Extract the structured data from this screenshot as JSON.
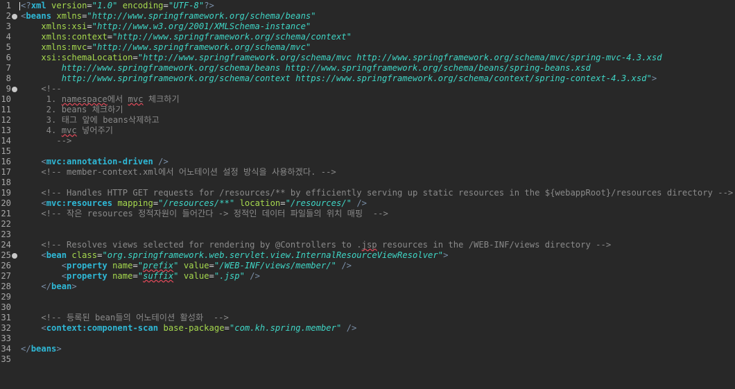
{
  "editor": {
    "lines": [
      {
        "n": "1",
        "fold": false,
        "parts": [
          {
            "c": "tag",
            "t": "<?"
          },
          {
            "c": "tn",
            "t": "xml"
          },
          {
            "c": "txt",
            "t": " "
          },
          {
            "c": "attr",
            "t": "version"
          },
          {
            "c": "txt",
            "t": "="
          },
          {
            "c": "val",
            "t": "\"1.0\""
          },
          {
            "c": "txt",
            "t": " "
          },
          {
            "c": "attr",
            "t": "encoding"
          },
          {
            "c": "txt",
            "t": "="
          },
          {
            "c": "val",
            "t": "\"UTF-8\""
          },
          {
            "c": "tag",
            "t": "?>"
          }
        ]
      },
      {
        "n": "2",
        "fold": true,
        "parts": [
          {
            "c": "tag",
            "t": "<"
          },
          {
            "c": "tn",
            "t": "beans"
          },
          {
            "c": "txt",
            "t": " "
          },
          {
            "c": "attr",
            "t": "xmlns"
          },
          {
            "c": "txt",
            "t": "="
          },
          {
            "c": "val",
            "t": "\"http://www.springframework.org/schema/beans\""
          }
        ]
      },
      {
        "n": "3",
        "fold": false,
        "parts": [
          {
            "c": "txt",
            "t": "    "
          },
          {
            "c": "attr",
            "t": "xmlns:xsi"
          },
          {
            "c": "txt",
            "t": "="
          },
          {
            "c": "val",
            "t": "\"http://www.w3.org/2001/XMLSchema-instance\""
          }
        ]
      },
      {
        "n": "4",
        "fold": false,
        "parts": [
          {
            "c": "txt",
            "t": "    "
          },
          {
            "c": "attr",
            "t": "xmlns:context"
          },
          {
            "c": "txt",
            "t": "="
          },
          {
            "c": "val",
            "t": "\"http://www.springframework.org/schema/context\""
          }
        ]
      },
      {
        "n": "5",
        "fold": false,
        "parts": [
          {
            "c": "txt",
            "t": "    "
          },
          {
            "c": "attr",
            "t": "xmlns:mvc"
          },
          {
            "c": "txt",
            "t": "="
          },
          {
            "c": "val",
            "t": "\"http://www.springframework.org/schema/mvc\""
          }
        ]
      },
      {
        "n": "6",
        "fold": false,
        "parts": [
          {
            "c": "txt",
            "t": "    "
          },
          {
            "c": "attr",
            "t": "xsi:schemaLocation"
          },
          {
            "c": "txt",
            "t": "="
          },
          {
            "c": "val",
            "t": "\"http://www.springframework.org/schema/mvc http://www.springframework.org/schema/mvc/spring-mvc-4.3.xsd"
          }
        ]
      },
      {
        "n": "7",
        "fold": false,
        "parts": [
          {
            "c": "val",
            "t": "        http://www.springframework.org/schema/beans http://www.springframework.org/schema/beans/spring-beans.xsd"
          }
        ]
      },
      {
        "n": "8",
        "fold": false,
        "parts": [
          {
            "c": "val",
            "t": "        http://www.springframework.org/schema/context https://www.springframework.org/schema/context/spring-context-4.3.xsd\""
          },
          {
            "c": "tag",
            "t": ">"
          }
        ]
      },
      {
        "n": "9",
        "fold": true,
        "parts": [
          {
            "c": "cmt",
            "t": "    <!--"
          }
        ]
      },
      {
        "n": "10",
        "fold": false,
        "parts": [
          {
            "c": "cmt",
            "t": "     1. "
          },
          {
            "c": "cmt sq",
            "t": "namespace"
          },
          {
            "c": "cmt",
            "t": "에서 "
          },
          {
            "c": "cmt sq",
            "t": "mvc"
          },
          {
            "c": "cmt",
            "t": " 체크하기"
          }
        ]
      },
      {
        "n": "11",
        "fold": false,
        "parts": [
          {
            "c": "cmt",
            "t": "     2. beans 체크하기"
          }
        ]
      },
      {
        "n": "12",
        "fold": false,
        "parts": [
          {
            "c": "cmt",
            "t": "     3. 태그 앞에 beans삭제하고"
          }
        ]
      },
      {
        "n": "13",
        "fold": false,
        "parts": [
          {
            "c": "cmt",
            "t": "     4. "
          },
          {
            "c": "cmt sq",
            "t": "mvc"
          },
          {
            "c": "cmt",
            "t": " 넣어주기"
          }
        ]
      },
      {
        "n": "14",
        "fold": false,
        "parts": [
          {
            "c": "cmt",
            "t": "       -->"
          }
        ]
      },
      {
        "n": "15",
        "fold": false,
        "parts": []
      },
      {
        "n": "16",
        "fold": false,
        "parts": [
          {
            "c": "txt",
            "t": "    "
          },
          {
            "c": "tag",
            "t": "<"
          },
          {
            "c": "tn",
            "t": "mvc:annotation-driven"
          },
          {
            "c": "txt",
            "t": " "
          },
          {
            "c": "tag",
            "t": "/>"
          }
        ]
      },
      {
        "n": "17",
        "fold": false,
        "parts": [
          {
            "c": "cmt",
            "t": "    <!-- member-context.xml에서 어노테이션 설정 방식을 사용하겠다. -->"
          }
        ]
      },
      {
        "n": "18",
        "fold": false,
        "parts": []
      },
      {
        "n": "19",
        "fold": false,
        "parts": [
          {
            "c": "cmt",
            "t": "    <!-- Handles HTTP GET requests for /resources/** by efficiently serving up static resources in the ${webappRoot}/resources directory -->"
          }
        ]
      },
      {
        "n": "20",
        "fold": false,
        "parts": [
          {
            "c": "txt",
            "t": "    "
          },
          {
            "c": "tag",
            "t": "<"
          },
          {
            "c": "tn",
            "t": "mvc:resources"
          },
          {
            "c": "txt",
            "t": " "
          },
          {
            "c": "attr",
            "t": "mapping"
          },
          {
            "c": "txt",
            "t": "="
          },
          {
            "c": "val",
            "t": "\"/resources/**\""
          },
          {
            "c": "txt",
            "t": " "
          },
          {
            "c": "attr",
            "t": "location"
          },
          {
            "c": "txt",
            "t": "="
          },
          {
            "c": "val",
            "t": "\"/resources/\""
          },
          {
            "c": "txt",
            "t": " "
          },
          {
            "c": "tag",
            "t": "/>"
          }
        ]
      },
      {
        "n": "21",
        "fold": false,
        "parts": [
          {
            "c": "cmt",
            "t": "    <!-- 작은 resources 정적자원이 들어간다 -> 정적인 데이터 파일들의 위치 매핑  -->"
          }
        ]
      },
      {
        "n": "22",
        "fold": false,
        "parts": []
      },
      {
        "n": "23",
        "fold": false,
        "parts": []
      },
      {
        "n": "24",
        "fold": false,
        "parts": [
          {
            "c": "cmt",
            "t": "    <!-- Resolves views selected for rendering by @Controllers to ."
          },
          {
            "c": "cmt sq",
            "t": "jsp"
          },
          {
            "c": "cmt",
            "t": " resources in the /WEB-INF/views directory -->"
          }
        ]
      },
      {
        "n": "25",
        "fold": true,
        "parts": [
          {
            "c": "txt",
            "t": "    "
          },
          {
            "c": "tag",
            "t": "<"
          },
          {
            "c": "tn",
            "t": "bean"
          },
          {
            "c": "txt",
            "t": " "
          },
          {
            "c": "attr",
            "t": "class"
          },
          {
            "c": "txt",
            "t": "="
          },
          {
            "c": "val",
            "t": "\"org.springframework.web.servlet.view.InternalResourceViewResolver\""
          },
          {
            "c": "tag",
            "t": ">"
          }
        ]
      },
      {
        "n": "26",
        "fold": false,
        "parts": [
          {
            "c": "txt",
            "t": "        "
          },
          {
            "c": "tag",
            "t": "<"
          },
          {
            "c": "tn",
            "t": "property"
          },
          {
            "c": "txt",
            "t": " "
          },
          {
            "c": "attr",
            "t": "name"
          },
          {
            "c": "txt",
            "t": "="
          },
          {
            "c": "val",
            "t": "\""
          },
          {
            "c": "val sq",
            "t": "prefix"
          },
          {
            "c": "val",
            "t": "\""
          },
          {
            "c": "txt",
            "t": " "
          },
          {
            "c": "attr",
            "t": "value"
          },
          {
            "c": "txt",
            "t": "="
          },
          {
            "c": "val",
            "t": "\"/WEB-INF/views/member/\""
          },
          {
            "c": "txt",
            "t": " "
          },
          {
            "c": "tag",
            "t": "/>"
          }
        ]
      },
      {
        "n": "27",
        "fold": false,
        "parts": [
          {
            "c": "txt",
            "t": "        "
          },
          {
            "c": "tag",
            "t": "<"
          },
          {
            "c": "tn",
            "t": "property"
          },
          {
            "c": "txt",
            "t": " "
          },
          {
            "c": "attr",
            "t": "name"
          },
          {
            "c": "txt",
            "t": "="
          },
          {
            "c": "val",
            "t": "\""
          },
          {
            "c": "val sq",
            "t": "suffix"
          },
          {
            "c": "val",
            "t": "\""
          },
          {
            "c": "txt",
            "t": " "
          },
          {
            "c": "attr",
            "t": "value"
          },
          {
            "c": "txt",
            "t": "="
          },
          {
            "c": "val",
            "t": "\".jsp\""
          },
          {
            "c": "txt",
            "t": " "
          },
          {
            "c": "tag",
            "t": "/>"
          }
        ]
      },
      {
        "n": "28",
        "fold": false,
        "parts": [
          {
            "c": "txt",
            "t": "    "
          },
          {
            "c": "tag",
            "t": "</"
          },
          {
            "c": "tn",
            "t": "bean"
          },
          {
            "c": "tag",
            "t": ">"
          }
        ]
      },
      {
        "n": "29",
        "fold": false,
        "parts": []
      },
      {
        "n": "30",
        "fold": false,
        "parts": []
      },
      {
        "n": "31",
        "fold": false,
        "parts": [
          {
            "c": "cmt",
            "t": "    <!-- 등록된 bean들의 어노테이션 활성화  -->"
          }
        ]
      },
      {
        "n": "32",
        "fold": false,
        "parts": [
          {
            "c": "txt",
            "t": "    "
          },
          {
            "c": "tag",
            "t": "<"
          },
          {
            "c": "tn",
            "t": "context:component-scan"
          },
          {
            "c": "txt",
            "t": " "
          },
          {
            "c": "attr",
            "t": "base-package"
          },
          {
            "c": "txt",
            "t": "="
          },
          {
            "c": "val",
            "t": "\"com.kh.spring.member\""
          },
          {
            "c": "txt",
            "t": " "
          },
          {
            "c": "tag",
            "t": "/>"
          }
        ]
      },
      {
        "n": "33",
        "fold": false,
        "parts": []
      },
      {
        "n": "34",
        "fold": false,
        "parts": [
          {
            "c": "tag",
            "t": "</"
          },
          {
            "c": "tn",
            "t": "beans"
          },
          {
            "c": "tag",
            "t": ">"
          }
        ]
      },
      {
        "n": "35",
        "fold": false,
        "parts": []
      }
    ]
  }
}
